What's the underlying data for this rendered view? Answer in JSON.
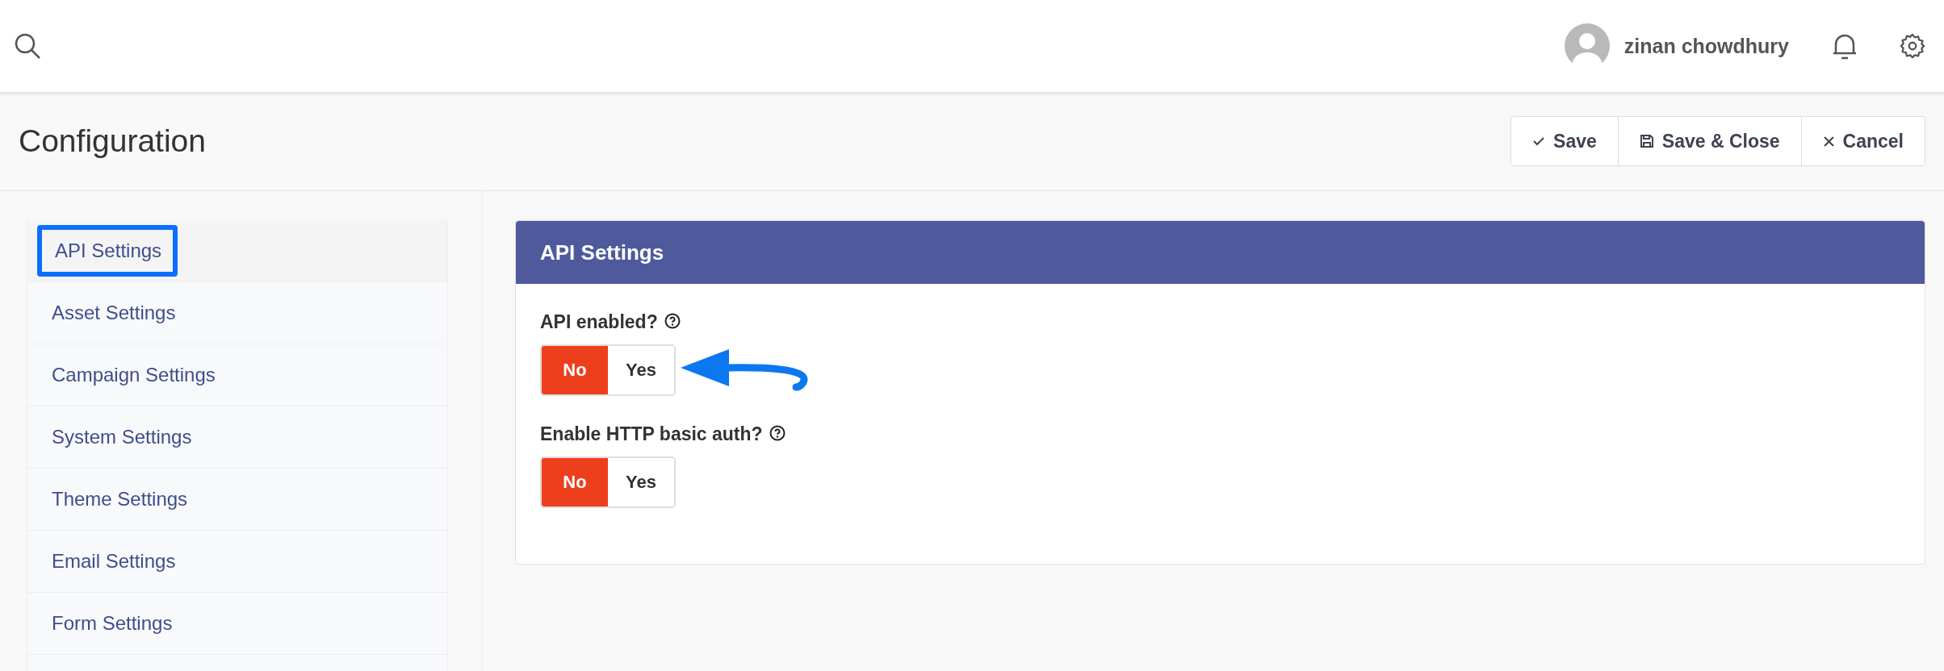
{
  "header": {
    "user_name": "zinan chowdhury"
  },
  "page": {
    "title": "Configuration"
  },
  "actions": [
    {
      "kind": "check",
      "label": "Save"
    },
    {
      "kind": "disk",
      "label": "Save & Close"
    },
    {
      "kind": "cross",
      "label": "Cancel"
    }
  ],
  "sidebar": {
    "items": [
      {
        "label": "API Settings",
        "selected": true
      },
      {
        "label": "Asset Settings",
        "selected": false
      },
      {
        "label": "Campaign Settings",
        "selected": false
      },
      {
        "label": "System Settings",
        "selected": false
      },
      {
        "label": "Theme Settings",
        "selected": false
      },
      {
        "label": "Email Settings",
        "selected": false
      },
      {
        "label": "Form Settings",
        "selected": false
      }
    ]
  },
  "panel": {
    "title": "API Settings",
    "fields": [
      {
        "label": "API enabled?",
        "options": [
          {
            "label": "No",
            "selected": true
          },
          {
            "label": "Yes",
            "selected": false
          }
        ],
        "annotated": true
      },
      {
        "label": "Enable HTTP basic auth?",
        "options": [
          {
            "label": "No",
            "selected": true
          },
          {
            "label": "Yes",
            "selected": false
          }
        ],
        "annotated": false
      }
    ]
  }
}
